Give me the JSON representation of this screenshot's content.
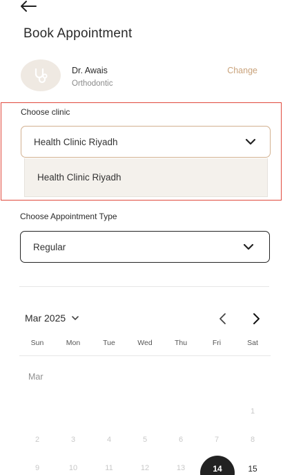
{
  "header": {
    "title": "Book Appointment"
  },
  "doctor": {
    "name": "Dr. Awais",
    "specialty": "Orthodontic",
    "change_label": "Change"
  },
  "clinic": {
    "label": "Choose clinic",
    "selected": "Health Clinic Riyadh",
    "options": [
      "Health Clinic Riyadh"
    ]
  },
  "appointment_type": {
    "label": "Choose Appointment Type",
    "selected": "Regular"
  },
  "calendar": {
    "month_label": "Mar 2025",
    "inline_month": "Mar",
    "weekdays": [
      "Sun",
      "Mon",
      "Tue",
      "Wed",
      "Thu",
      "Fri",
      "Sat"
    ],
    "row1": [
      "1"
    ],
    "row2": [
      "2",
      "3",
      "4",
      "5",
      "6",
      "7",
      "8"
    ],
    "row3": [
      "9",
      "10",
      "11",
      "12",
      "13",
      "14",
      "15"
    ],
    "selected_day": "14"
  },
  "colors": {
    "accent": "#c9a27a",
    "highlight_border": "#e0483b",
    "selected_day_bg": "#222222"
  }
}
